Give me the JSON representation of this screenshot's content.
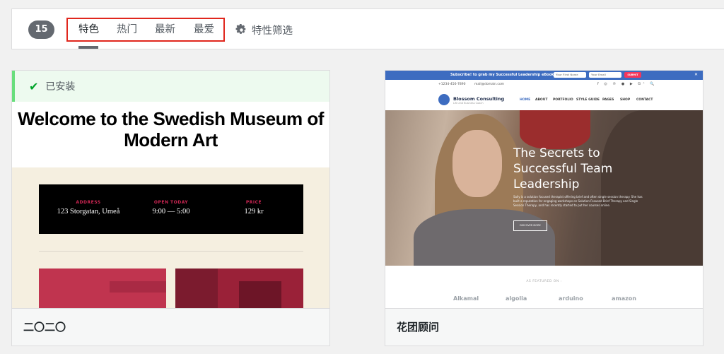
{
  "filter_bar": {
    "count": "15",
    "tabs": [
      {
        "label": "特色",
        "active": true
      },
      {
        "label": "热门",
        "active": false
      },
      {
        "label": "最新",
        "active": false
      },
      {
        "label": "最爱",
        "active": false
      }
    ],
    "feature_filter_label": "特性筛选",
    "icon": "gear-icon",
    "highlight_color": "#e0271d"
  },
  "themes": [
    {
      "name": "二〇二〇",
      "installed_label": "已安装",
      "preview": {
        "title": "Welcome to the Swedish Museum of Modern Art",
        "info": [
          {
            "label": "ADDRESS",
            "value": "123 Storgatan, Umeå"
          },
          {
            "label": "OPEN TODAY",
            "value": "9:00 — 5:00"
          },
          {
            "label": "PRICE",
            "value": "129 kr"
          }
        ],
        "accent": "#cd2653"
      }
    },
    {
      "name": "花团顾问",
      "preview": {
        "promo_text": "Subscribe! to grab my Successful Leadership eBook!",
        "promo_first_name": "Your First Name",
        "promo_email": "Your Email",
        "promo_button": "SUBMIT",
        "phone": "+1234-456-7890",
        "email": "mail@domain.com",
        "brand": "Blossom Consulting",
        "tagline": "Life and Business Coach",
        "nav": [
          "HOME",
          "ABOUT",
          "PORTFOLIO",
          "STYLE GUIDE",
          "PAGES",
          "SHOP",
          "CONTACT"
        ],
        "hero_title": "The Secrets to Successful Team Leadership",
        "hero_text": "Sally is a solution focused therapist offering brief and often single session therapy. She has built a reputation for engaging workshops on Solution Focused Brief Therapy and Single Session Therapy, and has recently started to put her courses online.",
        "hero_button": "DISCOVER MORE",
        "featured_label": "AS FEATURED ON :",
        "logos": [
          "Alkamal",
          "algolia",
          "arduino",
          "amazon"
        ],
        "accent": "#3d6cc0"
      }
    }
  ]
}
